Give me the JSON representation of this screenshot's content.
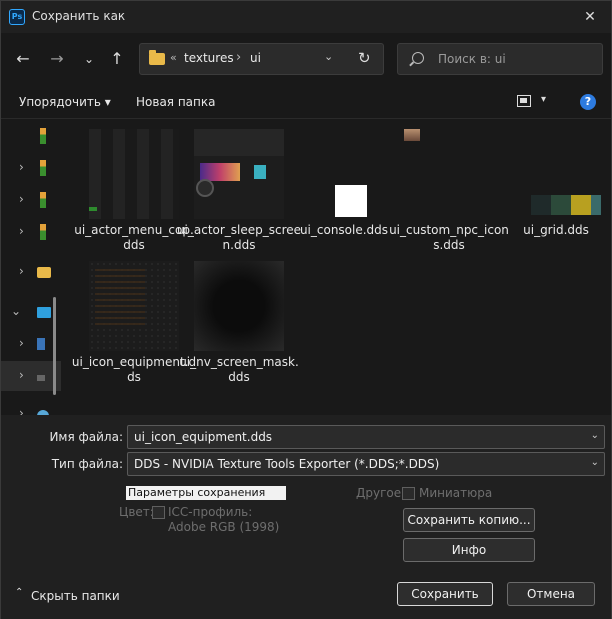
{
  "window": {
    "title": "Сохранить как",
    "app_icon_text": "Ps",
    "close_glyph": "✕"
  },
  "nav": {
    "back": "←",
    "forward": "→",
    "recent": "⌄",
    "up": "↑",
    "address_sep_root": "«",
    "address_parts": [
      "textures",
      "ui"
    ],
    "address_arrow": "›",
    "dropdown_glyph": "⌄",
    "refresh_glyph": "↻",
    "search_placeholder": "Поиск в: ui"
  },
  "toolbar": {
    "organize": "Упорядочить ▾",
    "new_folder": "Новая папка",
    "help": "?",
    "view_chevron": "▾"
  },
  "sidebar": {
    "rows": [
      {
        "chevron": "",
        "icon": "traffic"
      },
      {
        "chevron": "›",
        "icon": "traffic"
      },
      {
        "chevron": "›",
        "icon": "traffic"
      },
      {
        "chevron": "›",
        "icon": "traffic"
      },
      {
        "chevron": "›",
        "icon": "folder"
      },
      {
        "chevron": "⌄",
        "icon": "pc"
      },
      {
        "chevron": "›",
        "icon": "drive"
      },
      {
        "chevron": "›",
        "icon": "disk"
      },
      {
        "chevron": "›",
        "icon": "net"
      }
    ]
  },
  "files": [
    {
      "name": "ui_actor_menu_cop.dds",
      "thumb": "actor-menu"
    },
    {
      "name": "ui_actor_sleep_screen.dds",
      "thumb": "actor-sleep"
    },
    {
      "name": "ui_console.dds",
      "thumb": "console"
    },
    {
      "name": "ui_custom_npc_icons.dds",
      "thumb": "npc"
    },
    {
      "name": "ui_grid.dds",
      "thumb": "grid"
    },
    {
      "name": "ui_icon_equipment.dds",
      "thumb": "icon-eq"
    },
    {
      "name": "ui_nv_screen_mask.dds",
      "thumb": "nv"
    }
  ],
  "grid_swatches": [
    "#1f2a2a",
    "#2c4a3a",
    "#b8a020",
    "#3a6a6a"
  ],
  "form": {
    "filename_label": "Имя файла:",
    "filename_value": "ui_icon_equipment.dds",
    "filetype_label": "Тип файла:",
    "filetype_value": "DDS - NVIDIA Texture Tools Exporter (*.DDS;*.DDS)",
    "save_params": "Параметры сохранения",
    "other_label": "Другое:",
    "thumbnail_label": "Миниатюра",
    "color_label": "Цвет:",
    "icc_label": "ICC-профиль:  Adobe RGB (1998)",
    "save_copy": "Сохранить копию...",
    "info": "Инфо",
    "save": "Сохранить",
    "cancel": "Отмена",
    "hide_folders": "Скрыть папки",
    "hide_chevron": "⌃"
  }
}
